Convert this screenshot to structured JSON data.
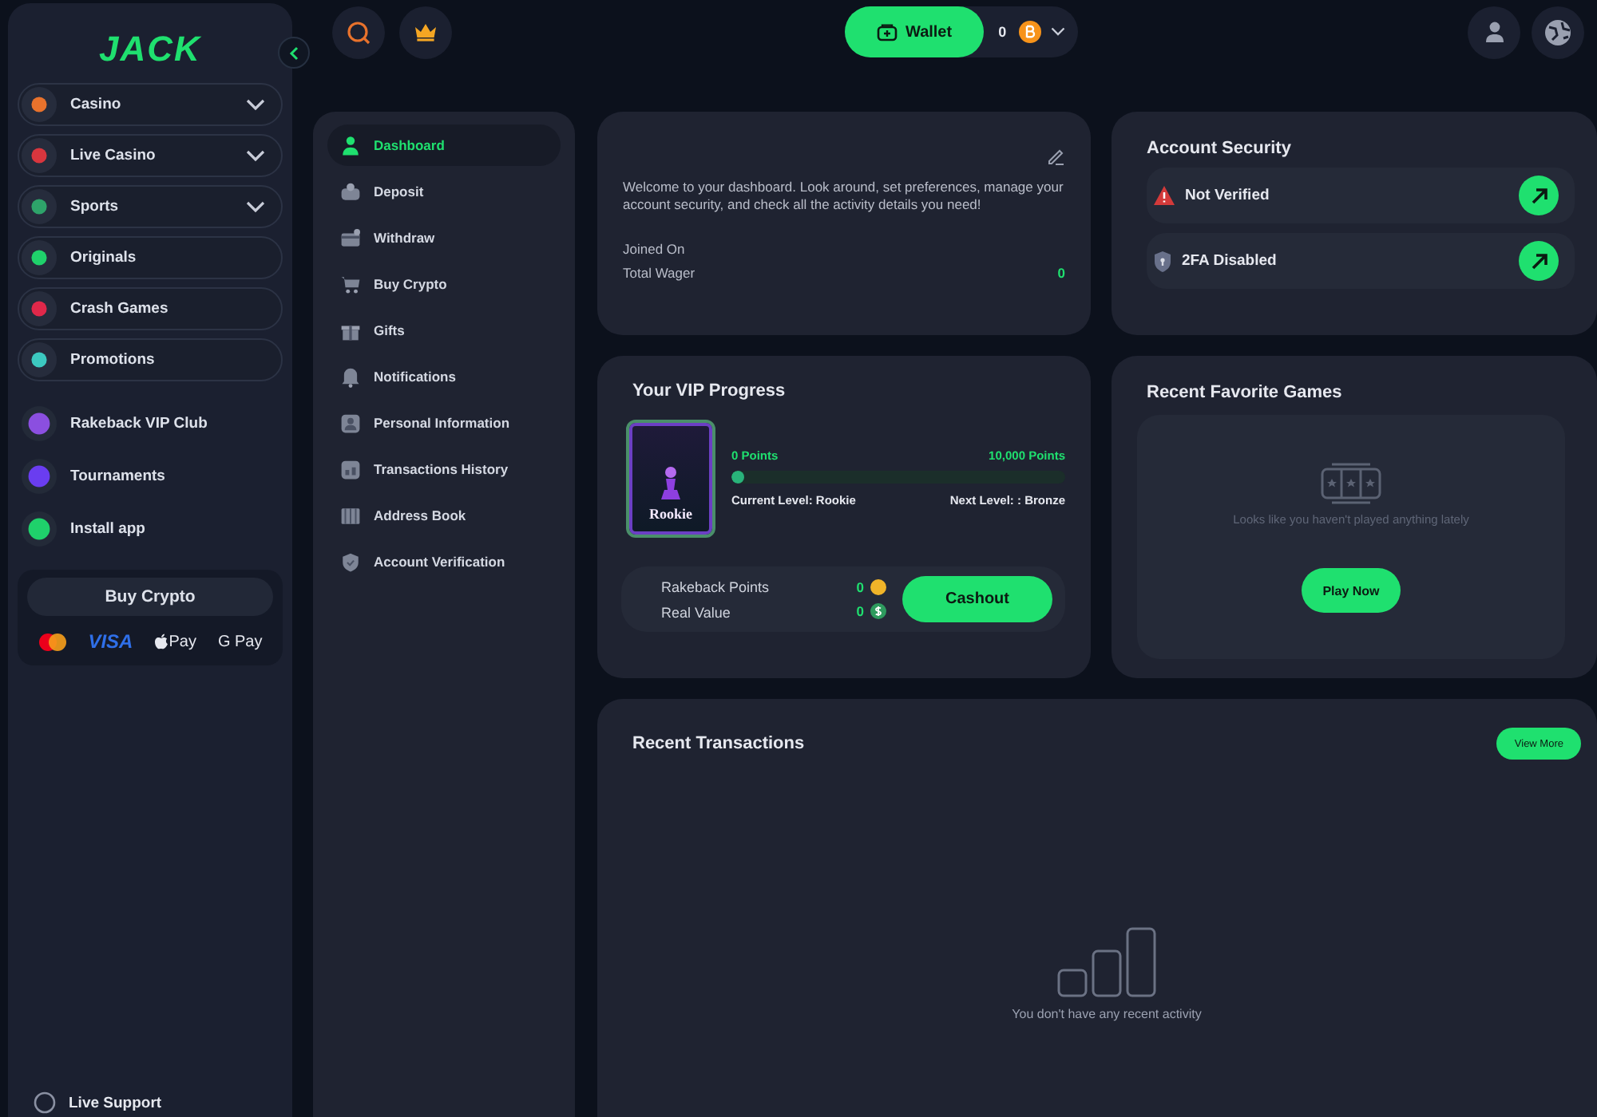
{
  "sidebar": {
    "logo": "JACK",
    "nav": [
      {
        "label": "Casino",
        "expandable": true,
        "color": "#e8722c"
      },
      {
        "label": "Live Casino",
        "expandable": true,
        "color": "#d9363e"
      },
      {
        "label": "Sports",
        "expandable": true,
        "color": "#2ea36a"
      },
      {
        "label": "Originals",
        "expandable": false,
        "color": "#1fd16b"
      },
      {
        "label": "Crash Games",
        "expandable": false,
        "color": "#e0284a"
      },
      {
        "label": "Promotions",
        "expandable": false,
        "color": "#3cc9c0"
      }
    ],
    "links": [
      {
        "label": "Rakeback VIP Club",
        "color": "#8b4fe0"
      },
      {
        "label": "Tournaments",
        "color": "#6a3df0"
      },
      {
        "label": "Install app",
        "color": "#1fd16b"
      }
    ],
    "buy_crypto": {
      "button": "Buy Crypto",
      "visa": "VISA",
      "apple_pay": "Pay",
      "google_pay": "G Pay"
    },
    "live_support": "Live Support"
  },
  "topbar": {
    "wallet_button": "Wallet",
    "balance": "0"
  },
  "account_menu": [
    {
      "label": "Dashboard",
      "selected": true
    },
    {
      "label": "Deposit",
      "selected": false
    },
    {
      "label": "Withdraw",
      "selected": false
    },
    {
      "label": "Buy Crypto",
      "selected": false
    },
    {
      "label": "Gifts",
      "selected": false
    },
    {
      "label": "Notifications",
      "selected": false
    },
    {
      "label": "Personal Information",
      "selected": false
    },
    {
      "label": "Transactions History",
      "selected": false
    },
    {
      "label": "Address Book",
      "selected": false
    },
    {
      "label": "Account Verification",
      "selected": false
    }
  ],
  "welcome": {
    "text": "Welcome to your dashboard. Look around, set preferences, manage your account security, and check all the activity details you need!",
    "joined_label": "Joined On",
    "wager_label": "Total Wager",
    "wager_value": "0"
  },
  "security": {
    "title": "Account Security",
    "items": [
      {
        "label": "Not Verified",
        "kind": "warning"
      },
      {
        "label": "2FA Disabled",
        "kind": "shield"
      }
    ]
  },
  "vip": {
    "title": "Your VIP Progress",
    "badge": "Rookie",
    "start": "0 Points",
    "end": "10,000 Points",
    "level": 0.02,
    "current": "Current Level: Rookie",
    "next": "Next Level: : Bronze",
    "rakeback_label": "Rakeback Points",
    "rakeback_value": "0",
    "real_label": "Real Value",
    "real_value": "0",
    "cashout": "Cashout"
  },
  "favorites": {
    "title": "Recent Favorite Games",
    "empty": "Looks like you haven't played anything lately",
    "button": "Play Now"
  },
  "transactions": {
    "title": "Recent Transactions",
    "button": "View More",
    "empty": "You don't have any recent activity"
  }
}
